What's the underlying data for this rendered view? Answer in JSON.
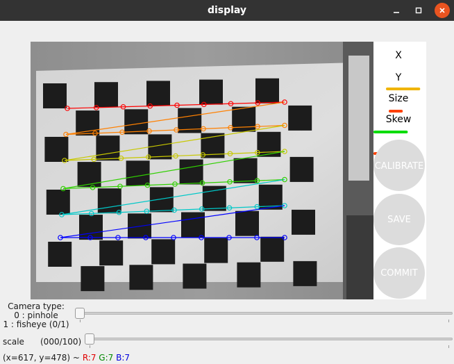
{
  "window": {
    "title": "display"
  },
  "panel": {
    "labels": {
      "x": "X",
      "y": "Y",
      "size": "Size",
      "skew": "Skew"
    },
    "progress": {
      "x": 0.0,
      "y": 0.85,
      "size": 0.3,
      "skew": 0.95,
      "extra": 0.15
    },
    "buttons": {
      "calibrate": "CALIBRATE",
      "save": "SAVE",
      "commit": "COMMIT"
    }
  },
  "controls": {
    "camera_type": {
      "label_line1": "Camera type:",
      "label_line2": "0 : pinhole",
      "label_line3": "1 : fisheye (0/1)",
      "value": 0,
      "max": 1
    },
    "scale": {
      "label": "scale",
      "value_label": "(000/100)",
      "value": 0,
      "max": 100
    }
  },
  "status": {
    "coords": "(x=617, y=478) ~",
    "r": "R:7",
    "g": "G:7",
    "b": "B:7"
  },
  "colors": {
    "titlebar": "#333333",
    "close_button": "#e95420",
    "bar_y": "#f0b400",
    "bar_size": "#ff4000",
    "bar_skew": "#00dd00",
    "bar_extra": "#ff4000",
    "button_disabled": "#dcdcdc"
  },
  "icons": [
    "minimize-icon",
    "maximize-icon",
    "close-icon"
  ]
}
